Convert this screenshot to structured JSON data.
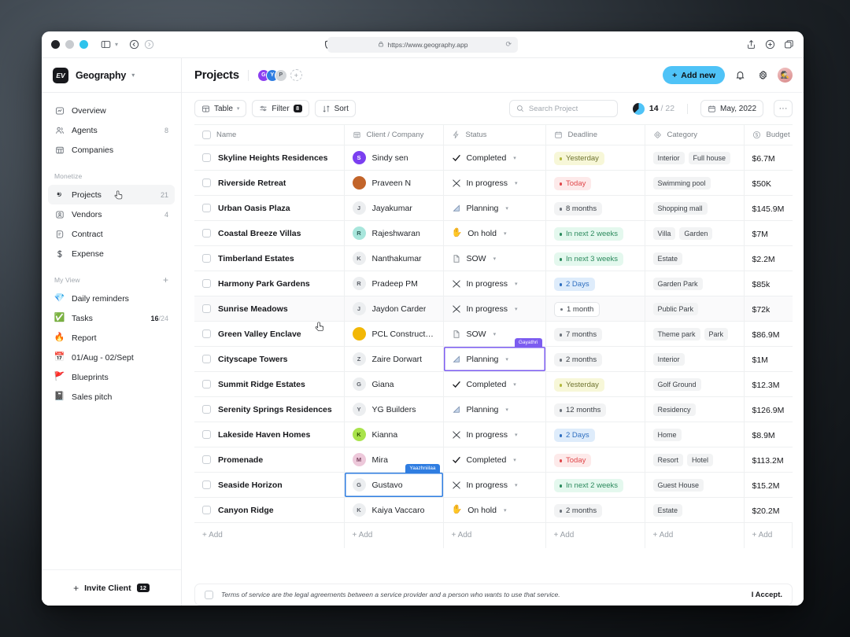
{
  "browser": {
    "url": "https://www.geography.app",
    "shield_icon": "shield-check-icon",
    "lock_icon": "lock-icon",
    "reload_icon": "reload-icon",
    "sidebar_toggle_icon": "sidebar-toggle-icon",
    "back_icon": "back-icon",
    "forward_icon": "forward-icon",
    "share_icon": "share-icon",
    "new_tab_icon": "new-tab-icon",
    "copy_icon": "tabs-overview-icon"
  },
  "sidebar": {
    "brand": {
      "logo_text": "EV",
      "name": "Geography",
      "chevron": "chevron-down-icon"
    },
    "primary_items": [
      {
        "label": "Overview",
        "icon": "overview-icon",
        "count": ""
      },
      {
        "label": "Agents",
        "icon": "agents-icon",
        "count": "8"
      },
      {
        "label": "Companies",
        "icon": "companies-icon",
        "count": ""
      }
    ],
    "monetize_title": "Monetize",
    "monetize_items": [
      {
        "label": "Projects",
        "icon": "projects-icon",
        "count": "21",
        "active": true
      },
      {
        "label": "Vendors",
        "icon": "vendors-icon",
        "count": "4",
        "active": false
      },
      {
        "label": "Contract",
        "icon": "contract-icon",
        "count": "",
        "active": false
      },
      {
        "label": "Expense",
        "icon": "expense-icon",
        "count": "",
        "active": false
      }
    ],
    "myview_title": "My View",
    "myview_add_icon": "plus-icon",
    "myview_items": [
      {
        "label": "Daily reminders",
        "emoji": "💎",
        "count": "",
        "count_sub": ""
      },
      {
        "label": "Tasks",
        "emoji": "✅",
        "count": "16",
        "count_sub": "/24"
      },
      {
        "label": "Report",
        "emoji": "🔥",
        "count": "",
        "count_sub": ""
      },
      {
        "label": "01/Aug - 02/Sept",
        "emoji": "📅",
        "count": "",
        "count_sub": ""
      },
      {
        "label": "Blueprints",
        "emoji": "🚩",
        "count": "",
        "count_sub": ""
      },
      {
        "label": "Sales pitch",
        "emoji": "📓",
        "count": "",
        "count_sub": ""
      }
    ],
    "footer": {
      "plus": "+",
      "label": "Invite Client",
      "badge": "12"
    }
  },
  "header": {
    "title": "Projects",
    "avatars": [
      {
        "initial": "G",
        "color": "#8b3ff0"
      },
      {
        "initial": "Y",
        "color": "#2f7de1"
      },
      {
        "initial": "P",
        "color": "#d4d7da"
      }
    ],
    "avatar_add": "+",
    "add_new_label": "Add new",
    "add_new_plus": "+",
    "accent_color": "#4fc3f7",
    "bell_icon": "bell-icon",
    "gear_icon": "gear-icon",
    "user_avatar_icon": "user-avatar"
  },
  "toolbar": {
    "view_label": "Table",
    "view_icon": "table-icon",
    "filter_label": "Filter",
    "filter_icon": "filter-icon",
    "filter_badge": "8",
    "sort_label": "Sort",
    "sort_icon": "sort-icon",
    "search_placeholder": "Search Project",
    "search_value": "",
    "search_icon": "search-icon",
    "progress_done": "14",
    "progress_total": "/ 22",
    "date_label": "May, 2022",
    "date_icon": "calendar-icon",
    "more_label": "···"
  },
  "table": {
    "columns": [
      {
        "label": "Name",
        "icon": "checkbox-icon"
      },
      {
        "label": "Client / Company",
        "icon": "company-icon"
      },
      {
        "label": "Status",
        "icon": "status-icon"
      },
      {
        "label": "Deadline",
        "icon": "calendar-icon"
      },
      {
        "label": "Category",
        "icon": "category-icon"
      },
      {
        "label": "Budget",
        "icon": "budget-icon"
      }
    ],
    "add_label": "Add",
    "rows": [
      {
        "name": "Skyline Heights Residences",
        "client": "Sindy sen",
        "avatar_initial": "S",
        "avatar_color": "#7b3ff0",
        "avatar_fg": "#ffffff",
        "status": "Completed",
        "status_icon": "check",
        "deadline": "Yesterday",
        "deadline_style": "yellow",
        "tags": [
          "Interior",
          "Full house"
        ],
        "budget": "$6.7M"
      },
      {
        "name": "Riverside Retreat",
        "client": "Praveen N",
        "avatar_initial": "",
        "avatar_color": "#c2642a",
        "avatar_fg": "#ffffff",
        "status": "In progress",
        "status_icon": "tools",
        "deadline": "Today",
        "deadline_style": "red",
        "tags": [
          "Swimming pool"
        ],
        "budget": "$50K"
      },
      {
        "name": "Urban Oasis Plaza",
        "client": "Jayakumar",
        "avatar_initial": "J",
        "avatar_color": "#eceef0",
        "avatar_fg": "#5c6169",
        "status": "Planning",
        "status_icon": "ruler",
        "deadline": "8 months",
        "deadline_style": "grey",
        "tags": [
          "Shopping mall"
        ],
        "budget": "$145.9M"
      },
      {
        "name": "Coastal Breeze Villas",
        "client": "Rajeshwaran",
        "avatar_initial": "R",
        "avatar_color": "#a8e6dc",
        "avatar_fg": "#2f5f58",
        "status": "On hold",
        "status_icon": "hand",
        "deadline": "In next 2 weeks",
        "deadline_style": "green",
        "tags": [
          "Villa",
          "Garden"
        ],
        "budget": "$7M"
      },
      {
        "name": "Timberland Estates",
        "client": "Nanthakumar",
        "avatar_initial": "K",
        "avatar_color": "#eceef0",
        "avatar_fg": "#5c6169",
        "status": "SOW",
        "status_icon": "doc",
        "deadline": "In next 3 weeks",
        "deadline_style": "green",
        "tags": [
          "Estate"
        ],
        "budget": "$2.2M"
      },
      {
        "name": "Harmony Park Gardens",
        "client": "Pradeep PM",
        "avatar_initial": "R",
        "avatar_color": "#eceef0",
        "avatar_fg": "#5c6169",
        "status": "In progress",
        "status_icon": "tools",
        "deadline": "2 Days",
        "deadline_style": "blue",
        "tags": [
          "Garden Park"
        ],
        "budget": "$85k"
      },
      {
        "name": "Sunrise Meadows",
        "client": "Jaydon Carder",
        "avatar_initial": "J",
        "avatar_color": "#eceef0",
        "avatar_fg": "#5c6169",
        "status": "In progress",
        "status_icon": "tools",
        "deadline": "1 month",
        "deadline_style": "white",
        "tags": [
          "Public Park"
        ],
        "budget": "$72k",
        "hover": true
      },
      {
        "name": "Green Valley Enclave",
        "client": "PCL Construction",
        "avatar_initial": "",
        "avatar_color": "#f2b705",
        "avatar_fg": "#4a3c00",
        "status": "SOW",
        "status_icon": "doc",
        "deadline": "7 months",
        "deadline_style": "grey",
        "tags": [
          "Theme park",
          "Park"
        ],
        "budget": "$86.9M"
      },
      {
        "name": "Cityscape Towers",
        "client": "Zaire Dorwart",
        "avatar_initial": "Z",
        "avatar_color": "#eceef0",
        "avatar_fg": "#5c6169",
        "status": "Planning",
        "status_icon": "ruler",
        "deadline": "2 months",
        "deadline_style": "grey",
        "tags": [
          "Interior"
        ],
        "budget": "$1M",
        "status_selected": "purple",
        "status_selected_label": "Gayathri"
      },
      {
        "name": "Summit Ridge Estates",
        "client": "Giana",
        "avatar_initial": "G",
        "avatar_color": "#eceef0",
        "avatar_fg": "#5c6169",
        "status": "Completed",
        "status_icon": "check",
        "deadline": "Yesterday",
        "deadline_style": "yellow",
        "tags": [
          "Golf Ground"
        ],
        "budget": "$12.3M"
      },
      {
        "name": "Serenity Springs Residences",
        "client": "YG Builders",
        "avatar_initial": "Y",
        "avatar_color": "#eceef0",
        "avatar_fg": "#5c6169",
        "status": "Planning",
        "status_icon": "ruler",
        "deadline": "12 months",
        "deadline_style": "grey",
        "tags": [
          "Residency"
        ],
        "budget": "$126.9M"
      },
      {
        "name": "Lakeside Haven Homes",
        "client": "Kianna",
        "avatar_initial": "K",
        "avatar_color": "#a9e34b",
        "avatar_fg": "#2f5200",
        "status": "In progress",
        "status_icon": "tools",
        "deadline": "2 Days",
        "deadline_style": "blue",
        "tags": [
          "Home"
        ],
        "budget": "$8.9M"
      },
      {
        "name": "Promenade",
        "client": "Mira",
        "avatar_initial": "M",
        "avatar_color": "#edc8da",
        "avatar_fg": "#7a4560",
        "status": "Completed",
        "status_icon": "check",
        "deadline": "Today",
        "deadline_style": "red",
        "tags": [
          "Resort",
          "Hotel"
        ],
        "budget": "$113.2M"
      },
      {
        "name": "Seaside Horizon",
        "client": "Gustavo",
        "avatar_initial": "G",
        "avatar_color": "#eceef0",
        "avatar_fg": "#5c6169",
        "status": "In progress",
        "status_icon": "tools",
        "deadline": "In next 2 weeks",
        "deadline_style": "green",
        "tags": [
          "Guest House"
        ],
        "budget": "$15.2M",
        "client_selected": "blue",
        "client_selected_label": "Yaazhniilaa"
      },
      {
        "name": "Canyon Ridge",
        "client": "Kaiya Vaccaro",
        "avatar_initial": "K",
        "avatar_color": "#eceef0",
        "avatar_fg": "#5c6169",
        "status": "On hold",
        "status_icon": "hand",
        "deadline": "2 months",
        "deadline_style": "grey",
        "tags": [
          "Estate"
        ],
        "budget": "$20.2M"
      }
    ]
  },
  "terms": {
    "text": "Terms of service are the legal agreements between a service provider and a person who wants to use that service.",
    "accept_label": "I Accept."
  }
}
